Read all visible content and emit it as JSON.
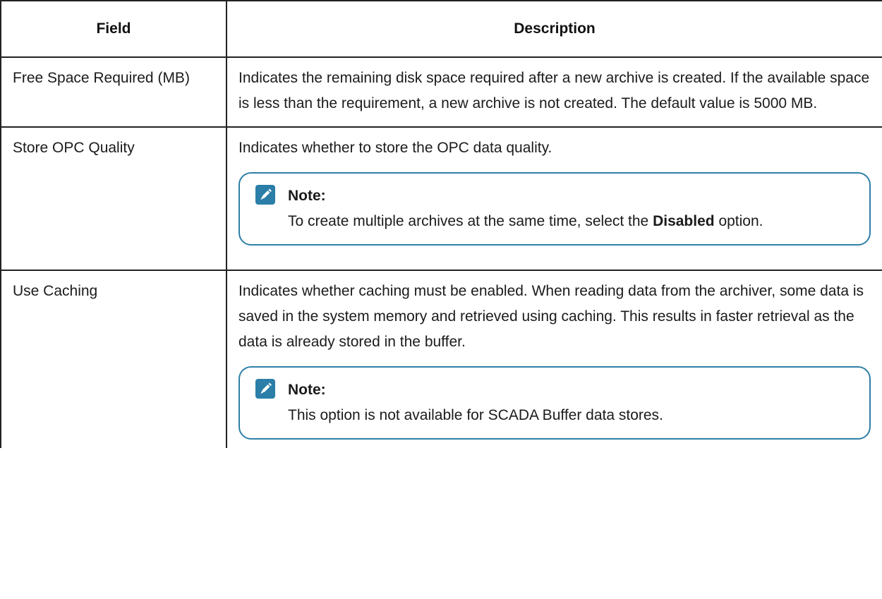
{
  "table": {
    "headers": {
      "field": "Field",
      "description": "Description"
    },
    "rows": [
      {
        "field": "Free Space Required (MB)",
        "description": "Indicates the remaining disk space required after a new archive is created. If the available space is less than the requirement, a new archive is not created. The default value is 5000 MB."
      },
      {
        "field": "Store OPC Quality",
        "description": "Indicates whether to store the OPC data quality.",
        "note": {
          "title": "Note:",
          "text_before": "To create multiple archives at the same time, select the ",
          "text_bold": "Disabled",
          "text_after": " option."
        }
      },
      {
        "field": "Use Caching",
        "description": "Indicates whether caching must be enabled. When reading data from the archiver, some data is saved in the system memory and retrieved using caching. This results in faster retrieval as the data is already stored in the buffer.",
        "note": {
          "title": "Note:",
          "text": "This option is not available for SCADA Buffer data stores."
        }
      }
    ]
  },
  "colors": {
    "note_border": "#2e7fa8",
    "note_icon": "#2b7ea8",
    "table_border": "#222222"
  },
  "icons": {
    "note": "note-pencil-icon"
  }
}
